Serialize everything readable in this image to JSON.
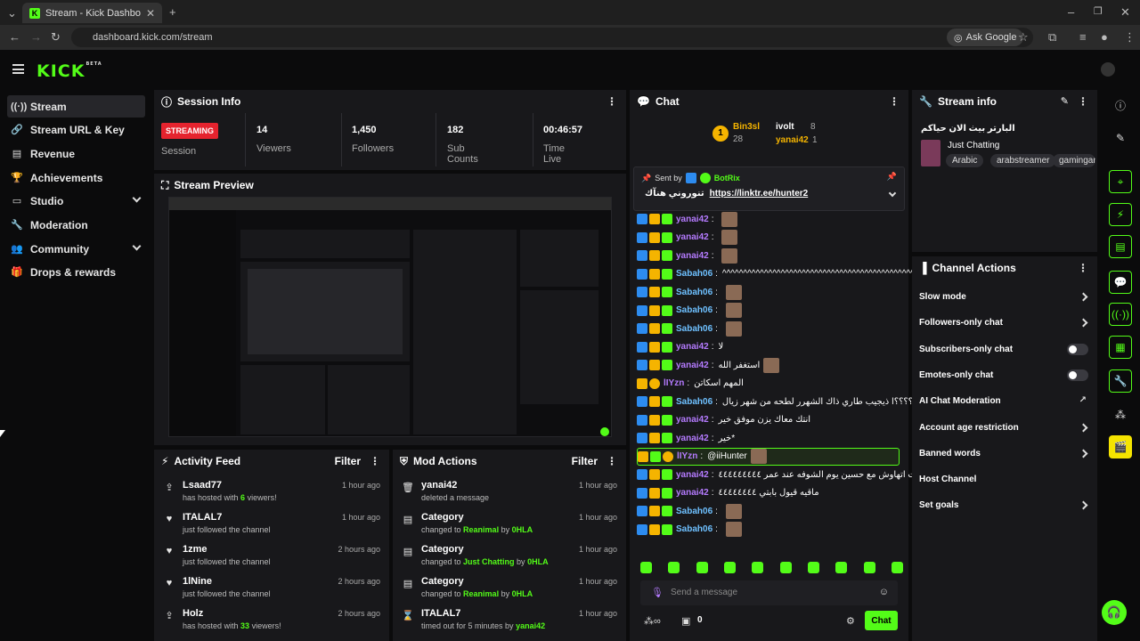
{
  "browser": {
    "tab_title": "Stream - Kick Dashboard",
    "url": "dashboard.kick.com/stream",
    "ask_google": "Ask Google"
  },
  "app": {
    "logo": "KICK",
    "logo_badge": "BETA"
  },
  "sidebar": {
    "items": [
      {
        "label": "Stream",
        "icon": "broadcast-icon"
      },
      {
        "label": "Stream URL & Key",
        "icon": "link-icon"
      },
      {
        "label": "Revenue",
        "icon": "chart-icon"
      },
      {
        "label": "Achievements",
        "icon": "trophy-icon"
      },
      {
        "label": "Studio",
        "icon": "studio-icon"
      },
      {
        "label": "Moderation",
        "icon": "wrench-icon"
      },
      {
        "label": "Community",
        "icon": "community-icon"
      },
      {
        "label": "Drops & rewards",
        "icon": "gift-icon"
      }
    ]
  },
  "session": {
    "title": "Session Info",
    "badge": "STREAMING",
    "badge_label": "Session",
    "stats": [
      {
        "value": "14",
        "label": "Viewers"
      },
      {
        "value": "1,450",
        "label": "Followers"
      },
      {
        "value": "182",
        "label": "Sub Counts"
      },
      {
        "value": "00:46:57",
        "label": "Time Live"
      }
    ]
  },
  "preview": {
    "title": "Stream Preview"
  },
  "activity": {
    "title": "Activity Feed",
    "filter": "Filter",
    "items": [
      {
        "name": "Lsaad77",
        "pre": "has hosted with ",
        "hl": "6",
        "post": " viewers!",
        "time": "1 hour ago",
        "icon": "host-icon"
      },
      {
        "name": "ITALAL7",
        "pre": "just followed the channel",
        "hl": "",
        "post": "",
        "time": "1 hour ago",
        "icon": "heart-icon"
      },
      {
        "name": "1zme",
        "pre": "just followed the channel",
        "hl": "",
        "post": "",
        "time": "2 hours ago",
        "icon": "heart-icon"
      },
      {
        "name": "1lNine",
        "pre": "just followed the channel",
        "hl": "",
        "post": "",
        "time": "2 hours ago",
        "icon": "heart-icon"
      },
      {
        "name": "Holz",
        "pre": "has hosted with ",
        "hl": "33",
        "post": " viewers!",
        "time": "2 hours ago",
        "icon": "host-icon"
      }
    ]
  },
  "mod_actions": {
    "title": "Mod Actions",
    "filter": "Filter",
    "items": [
      {
        "name": "yanai42",
        "pre": "deleted a message",
        "hl": "",
        "mid": "",
        "by": "",
        "time": "1 hour ago",
        "icon": "trash-icon"
      },
      {
        "name": "Category",
        "pre": "changed to ",
        "hl": "Reanimal",
        "mid": " by ",
        "by": "0HLA",
        "time": "1 hour ago",
        "icon": "category-icon"
      },
      {
        "name": "Category",
        "pre": "changed to ",
        "hl": "Just Chatting",
        "mid": " by ",
        "by": "0HLA",
        "time": "1 hour ago",
        "icon": "category-icon"
      },
      {
        "name": "Category",
        "pre": "changed to ",
        "hl": "Reanimal",
        "mid": " by ",
        "by": "0HLA",
        "time": "1 hour ago",
        "icon": "category-icon"
      },
      {
        "name": "ITALAL7",
        "pre": "timed out for 5 minutes by ",
        "hl": "",
        "mid": "",
        "by": "yanai42",
        "time": "1 hour ago",
        "icon": "hourglass-icon"
      }
    ]
  },
  "chat": {
    "title": "Chat",
    "leaderboard": [
      {
        "rank": "1",
        "name": "Bin3sl",
        "count": "28"
      },
      {
        "name": "ivolt",
        "count": "8"
      },
      {
        "name": "yanai42",
        "count": "1"
      }
    ],
    "pinned": {
      "sent_by": "Sent by",
      "sender": "BotRix",
      "text": "تنوروني هنآك",
      "link": "https://linktr.ee/hunter2"
    },
    "messages": [
      {
        "user": "yanai42",
        "color": "#b57bff",
        "text": "",
        "badges": [
          "mod",
          "crown",
          "sub"
        ],
        "emote": true
      },
      {
        "user": "yanai42",
        "color": "#b57bff",
        "text": "",
        "badges": [
          "mod",
          "crown",
          "sub"
        ],
        "emote": true
      },
      {
        "user": "yanai42",
        "color": "#b57bff",
        "text": "",
        "badges": [
          "mod",
          "crown",
          "sub"
        ],
        "emote": true
      },
      {
        "user": "Sabah06",
        "color": "#6ec0ff",
        "text": "^^^^^^^^^^^^^^^^^^^^^^^^^^^^^^^^^^^^^^^^^^^^^^",
        "badges": [
          "mod",
          "crown",
          "sub"
        ],
        "emote": false
      },
      {
        "user": "Sabah06",
        "color": "#6ec0ff",
        "text": "",
        "badges": [
          "mod",
          "crown",
          "sub"
        ],
        "emote": true
      },
      {
        "user": "Sabah06",
        "color": "#6ec0ff",
        "text": "",
        "badges": [
          "mod",
          "crown",
          "sub"
        ],
        "emote": true
      },
      {
        "user": "Sabah06",
        "color": "#6ec0ff",
        "text": "",
        "badges": [
          "mod",
          "crown",
          "sub"
        ],
        "emote": true
      },
      {
        "user": "yanai42",
        "color": "#b57bff",
        "text": "لا",
        "badges": [
          "mod",
          "crown",
          "sub"
        ],
        "emote": false
      },
      {
        "user": "yanai42",
        "color": "#b57bff",
        "text": "استغفر الله",
        "badges": [
          "mod",
          "crown",
          "sub"
        ],
        "emote": true
      },
      {
        "user": "lIYzn",
        "color": "#b57bff",
        "text": "المهم اسكاتن",
        "badges": [
          "crown",
          "gold"
        ],
        "emote": false
      },
      {
        "user": "Sabah06",
        "color": "#6ec0ff",
        "text": "؟؟؟؟ا ذيجيب طاري ذاك الشهرر لطحه من شهر زيال",
        "badges": [
          "mod",
          "crown",
          "sub"
        ],
        "emote": true
      },
      {
        "user": "yanai42",
        "color": "#b57bff",
        "text": "انتك معاك يزن موفق خير",
        "badges": [
          "mod",
          "crown",
          "sub"
        ],
        "emote": false
      },
      {
        "user": "yanai42",
        "color": "#b57bff",
        "text": "خير*",
        "badges": [
          "mod",
          "crown",
          "sub"
        ],
        "emote": false
      },
      {
        "user": "lIYzn",
        "color": "#b57bff",
        "text": "@iiHunter",
        "badges": [
          "crown",
          "sub",
          "gold"
        ],
        "emote": true,
        "highlight": true
      },
      {
        "user": "yanai42",
        "color": "#b57bff",
        "text": "كنت اتهاوش مع حسين يوم الشوفه عند عمر ٤٤٤٤٤٤٤٤٤",
        "badges": [
          "mod",
          "crown",
          "sub"
        ],
        "emote": false
      },
      {
        "user": "yanai42",
        "color": "#b57bff",
        "text": "ماقيه قيول بابتي ٤٤٤٤٤٤٤٤",
        "badges": [
          "mod",
          "crown",
          "sub"
        ],
        "emote": false
      },
      {
        "user": "Sabah06",
        "color": "#6ec0ff",
        "text": "",
        "badges": [
          "mod",
          "crown",
          "sub"
        ],
        "emote": true
      },
      {
        "user": "Sabah06",
        "color": "#6ec0ff",
        "text": "",
        "badges": [
          "mod",
          "crown",
          "sub"
        ],
        "emote": true
      }
    ],
    "input_placeholder": "Send a message",
    "points": "0",
    "chat_button": "Chat"
  },
  "stream_info": {
    "title": "Stream info",
    "stream_title": "البارتر بيث الان حياكم",
    "category": "Just Chatting",
    "tags": [
      "Arabic",
      "arabstreamer",
      "gamingarab"
    ]
  },
  "channel_actions": {
    "title": "Channel Actions",
    "rows": [
      {
        "label": "Slow mode",
        "control": "chevron"
      },
      {
        "label": "Followers-only chat",
        "control": "chevron"
      },
      {
        "label": "Subscribers-only chat",
        "control": "toggle"
      },
      {
        "label": "Emotes-only chat",
        "control": "toggle"
      },
      {
        "label": "AI Chat Moderation",
        "control": "external"
      },
      {
        "label": "Account age restriction",
        "control": "chevron"
      },
      {
        "label": "Banned words",
        "control": "chevron"
      },
      {
        "label": "Host Channel",
        "control": "none"
      },
      {
        "label": "Set goals",
        "control": "chevron"
      }
    ]
  },
  "colors": {
    "accent": "#53fc18",
    "live": "#e5232e",
    "panel": "#18181b"
  }
}
